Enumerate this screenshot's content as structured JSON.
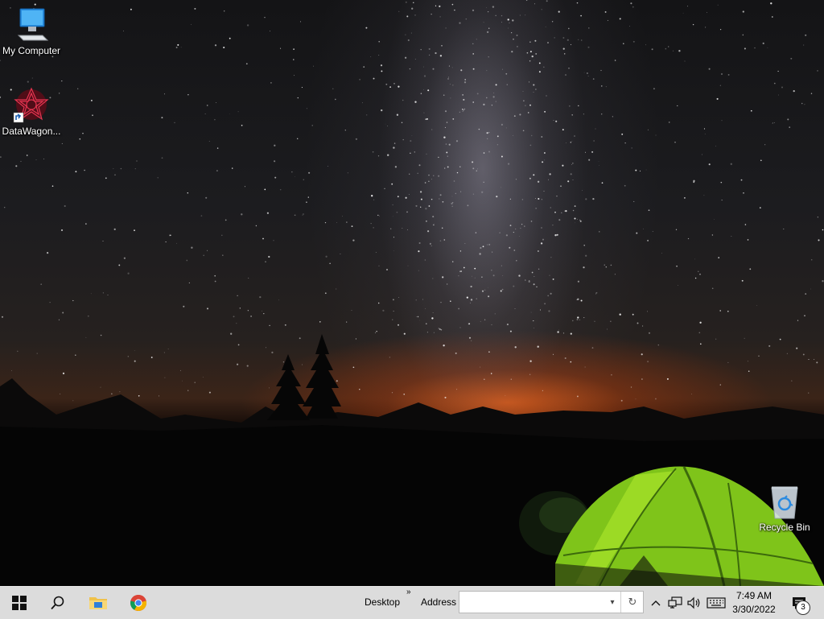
{
  "desktop": {
    "icons": [
      {
        "label": "My Computer",
        "icon": "monitor-icon"
      },
      {
        "label": "DataWagon...",
        "icon": "datawagon-app-icon"
      },
      {
        "label": "Recycle Bin",
        "icon": "recycle-bin-icon"
      }
    ]
  },
  "taskbar": {
    "start_icon": "windows-start-icon",
    "search_icon": "search-icon",
    "pinned": [
      {
        "name": "file-explorer",
        "icon": "folder-icon"
      },
      {
        "name": "chrome",
        "icon": "chrome-icon"
      }
    ],
    "toolbar_chevron": "»",
    "desktop_label": "Desktop",
    "address_label": "Address",
    "address_value": "",
    "address_go": "↻",
    "address_dropdown": "▾",
    "tray": {
      "overflow_icon": "chevron-up-icon",
      "network_icon": "network-icon",
      "volume_icon": "volume-icon",
      "keyboard_icon": "keyboard-icon",
      "time": "7:49 AM",
      "date": "3/30/2022",
      "notification_count": "3"
    }
  },
  "colors": {
    "taskbar_bg": "#dcdcdc",
    "tent_green": "#8fd11c",
    "glow_orange": "#e65f19"
  }
}
